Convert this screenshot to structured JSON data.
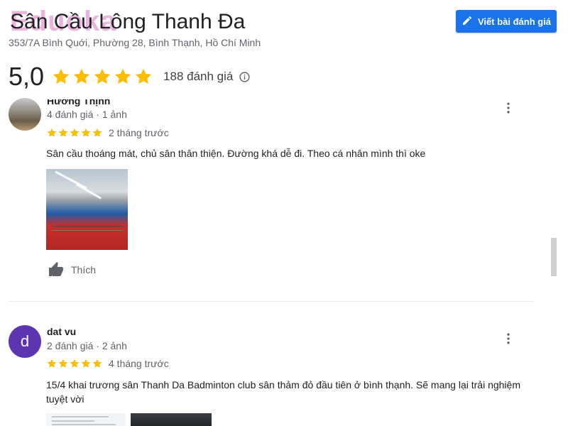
{
  "watermark": {
    "text": "Eduoka"
  },
  "place": {
    "title": "Sân Cầu Lông Thanh Đa",
    "address": "353/7A Bình Quới, Phường 28, Bình Thạnh, Hồ Chí Minh",
    "rating": "5,0",
    "stars": 5,
    "review_count": "188 đánh giá",
    "write_review_label": "Viết bài đánh giá"
  },
  "colors": {
    "accent": "#1a73e8",
    "star": "#fbbc04",
    "avatar_purple": "#5e35b1"
  },
  "reviews": [
    {
      "name": "Hương Thịnh",
      "meta": "4 đánh giá · 1 ảnh",
      "stars": 5,
      "time": "2 tháng trước",
      "text": "Sân cầu thoáng mát, chủ sân thân thiện. Đường khá dễ đi. Theo cá nhân mình thì oke",
      "like_label": "Thích"
    },
    {
      "name": "dat vu",
      "avatar_letter": "d",
      "meta": "2 đánh giá · 2 ảnh",
      "stars": 5,
      "time": "4 tháng trước",
      "text": "15/4 khai trương sân Thanh Da Badminton club sân thảm đỏ đầu tiên ở bình thạnh. Sẽ mang lại trải nghiệm tuyệt vời"
    }
  ],
  "icons": {
    "edit": "pencil-icon",
    "info": "info-icon",
    "more": "more-vertical-icon",
    "like": "thumbs-up-icon",
    "star": "star-icon"
  }
}
